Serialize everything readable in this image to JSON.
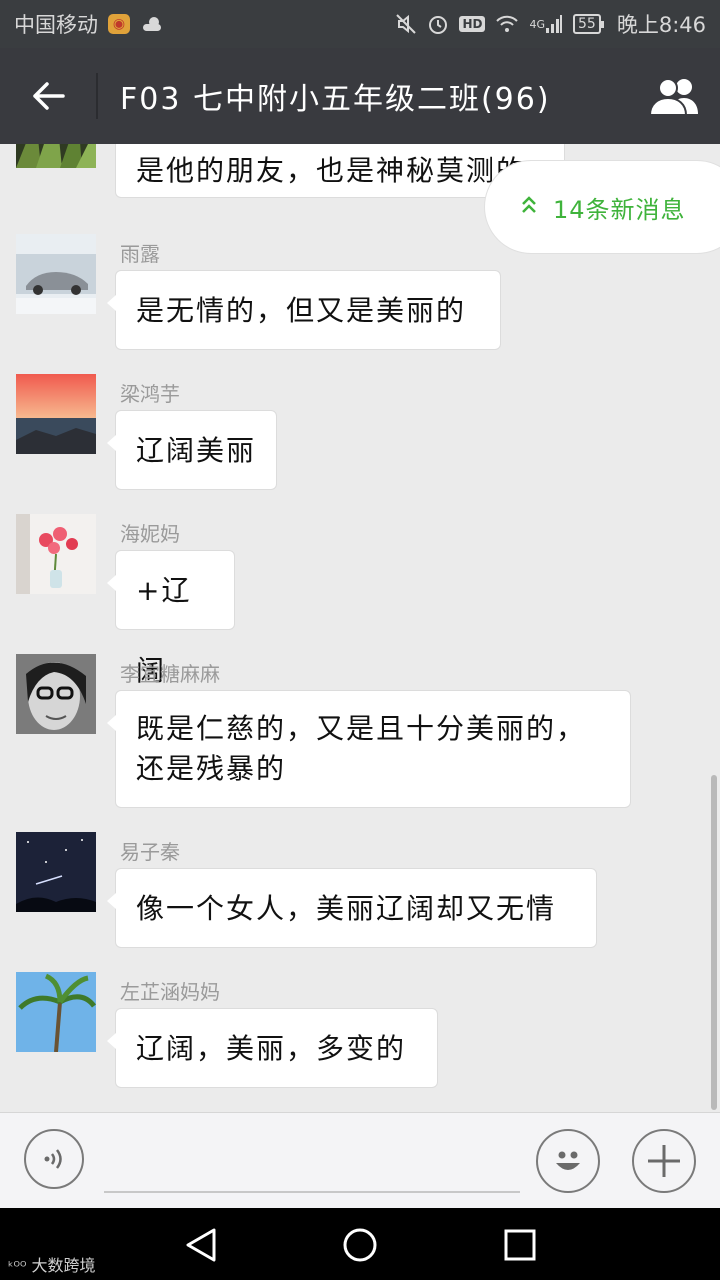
{
  "status_bar": {
    "carrier": "中国移动",
    "network": "4G",
    "battery": "55",
    "time": "晚上8:46",
    "icons": [
      "weibo-icon",
      "weather-icon",
      "mute-icon",
      "alarm-icon",
      "hd-icon",
      "wifi-icon",
      "signal-icon",
      "battery-icon"
    ]
  },
  "header": {
    "title": "F03 七中附小五年级二班(96)"
  },
  "new_messages": {
    "label": "14条新消息"
  },
  "messages": [
    {
      "sender": "",
      "text": "是他的朋友，也是神秘莫测的",
      "avatar": "palm-leaves"
    },
    {
      "sender": "雨露",
      "text": "是无情的，但又是美丽的",
      "avatar": "car"
    },
    {
      "sender": "梁鸿芋",
      "text": "辽阔美丽",
      "avatar": "sunset-sea"
    },
    {
      "sender": "海妮妈",
      "text": "+辽阔",
      "avatar": "flowers"
    },
    {
      "sender": "李宜糖麻麻",
      "text": "既是仁慈的，又是且十分美丽的，还是残暴的",
      "avatar": "woman-glasses"
    },
    {
      "sender": "易子秦",
      "text": "像一个女人，美丽辽阔却又无情",
      "avatar": "night-sky"
    },
    {
      "sender": "左芷涵妈妈",
      "text": "辽阔，美丽，多变的",
      "avatar": "palm-tree"
    }
  ],
  "input_bar": {
    "placeholder": ""
  },
  "watermark": "大数跨境",
  "colors": {
    "title_bar": "#393a3f",
    "chat_bg": "#ebebeb",
    "accent_green": "#3fb33b"
  }
}
